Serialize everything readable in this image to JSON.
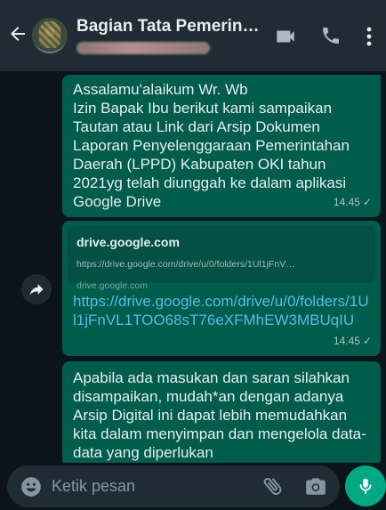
{
  "header": {
    "title": "Bagian Tata Pemerin…"
  },
  "messages": [
    {
      "text": "Assalamu'alaikum Wr. Wb\nIzin Bapak Ibu berikut kami sampaikan Tautan atau Link dari Arsip Dokumen Laporan Penyelenggaraan Pemerintahan Daerah (LPPD) Kabupaten OKI tahun 2021yg telah diunggah ke dalam aplikasi Google Drive",
      "time": "14.45",
      "status": "✓"
    },
    {
      "preview_title": "drive.google.com",
      "preview_url": "https://drive.google.com/drive/u/0/folders/1Ul1jFnV…",
      "preview_domain": "drive.google.com",
      "link": "https://drive.google.com/drive/u/0/folders/1Ul1jFnVL1TOO68sT76eXFMhEW3MBUqIU",
      "time": "14.45",
      "status": "✓"
    },
    {
      "text": "Apabila ada masukan dan saran silahkan disampaikan, mudah*an dengan adanya Arsip Digital ini dapat lebih memudahkan kita dalam menyimpan dan mengelola data-data yang diperlukan"
    }
  ],
  "composer": {
    "placeholder": "Ketik pesan"
  },
  "icons": {
    "back": "arrow-left-icon",
    "video": "video-camera-icon",
    "call": "phone-icon",
    "menu": "more-vert-icon",
    "forward": "forward-icon",
    "emoji": "emoji-icon",
    "attach": "paperclip-icon",
    "camera": "camera-icon",
    "mic": "microphone-icon"
  },
  "colors": {
    "header": "#1f2c34",
    "background": "#0b141a",
    "outgoing_bubble": "#005c4b",
    "link": "#53bdeb",
    "accent": "#00a884"
  }
}
